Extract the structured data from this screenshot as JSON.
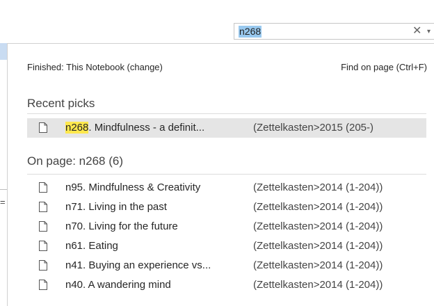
{
  "search": {
    "query": "n268",
    "clear_glyph": "✕",
    "dropdown_glyph": "▾"
  },
  "scope": {
    "label": "Finished:  This Notebook (change)",
    "find_on_page": "Find on page (Ctrl+F)"
  },
  "recent": {
    "header": "Recent picks",
    "items": [
      {
        "match": "n268",
        "rest": ". Mindfulness - a definit...",
        "location": "(Zettelkasten>2015 (205-)",
        "selected": true
      }
    ]
  },
  "on_page": {
    "header": "On page:  n268 (6)",
    "items": [
      {
        "title": "n95. Mindfulness & Creativity",
        "location": "(Zettelkasten>2014 (1-204))"
      },
      {
        "title": "n71. Living in the past",
        "location": "(Zettelkasten>2014 (1-204))"
      },
      {
        "title": "n70. Living for the future",
        "location": "(Zettelkasten>2014 (1-204))"
      },
      {
        "title": "n61. Eating",
        "location": "(Zettelkasten>2014 (1-204))"
      },
      {
        "title": "n41. Buying an experience vs...",
        "location": "(Zettelkasten>2014 (1-204))"
      },
      {
        "title": "n40. A wandering mind",
        "location": "(Zettelkasten>2014 (1-204))"
      }
    ]
  },
  "background": {
    "edge_glyph": "="
  },
  "colors": {
    "query_highlight": "#99c9ef",
    "match_highlight": "#ffe84d",
    "selected_row": "#e5e5e5"
  }
}
